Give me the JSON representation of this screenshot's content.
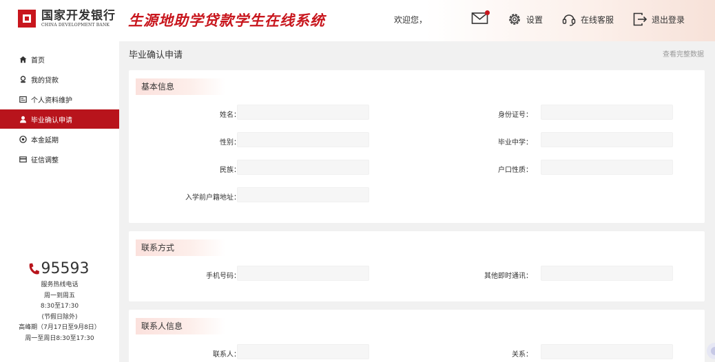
{
  "header": {
    "bank_name_cn": "国家开发银行",
    "bank_name_en": "CHINA DEVELOPMENT BANK",
    "system_title": "生源地助学贷款学生在线系统",
    "welcome": "欢迎您，",
    "settings_label": "设置",
    "service_label": "在线客服",
    "logout_label": "退出登录",
    "brand_color": "#c8161d"
  },
  "sidebar": {
    "items": [
      {
        "label": "首页",
        "icon": "home-icon"
      },
      {
        "label": "我的贷款",
        "icon": "loan-icon"
      },
      {
        "label": "个人资料维护",
        "icon": "profile-card-icon"
      },
      {
        "label": "毕业确认申请",
        "icon": "user-icon",
        "active": true
      },
      {
        "label": "本金延期",
        "icon": "coin-icon"
      },
      {
        "label": "征信调整",
        "icon": "credit-card-icon"
      }
    ],
    "hotline": {
      "number": "95593",
      "lines": [
        "服务热线电话",
        "周一到周五",
        "8:30至17:30",
        "(节假日除外)",
        "高峰期（7月17日至9月8日）",
        "周一至周日8:30至17:30"
      ]
    }
  },
  "main": {
    "page_title": "毕业确认申请",
    "view_all": "查看完整数据",
    "sections": {
      "basic": {
        "title": "基本信息",
        "name_label": "姓名：",
        "id_label": "身份证号：",
        "gender_label": "性别：",
        "school_label": "毕业中学：",
        "ethnicity_label": "民族：",
        "household_label": "户口性质：",
        "address_label": "入学前户籍地址："
      },
      "contact": {
        "title": "联系方式",
        "phone_label": "手机号码：",
        "im_label": "其他即时通讯："
      },
      "contact_person": {
        "title": "联系人信息",
        "person_label": "联系人：",
        "relation_label": "关系："
      }
    }
  }
}
